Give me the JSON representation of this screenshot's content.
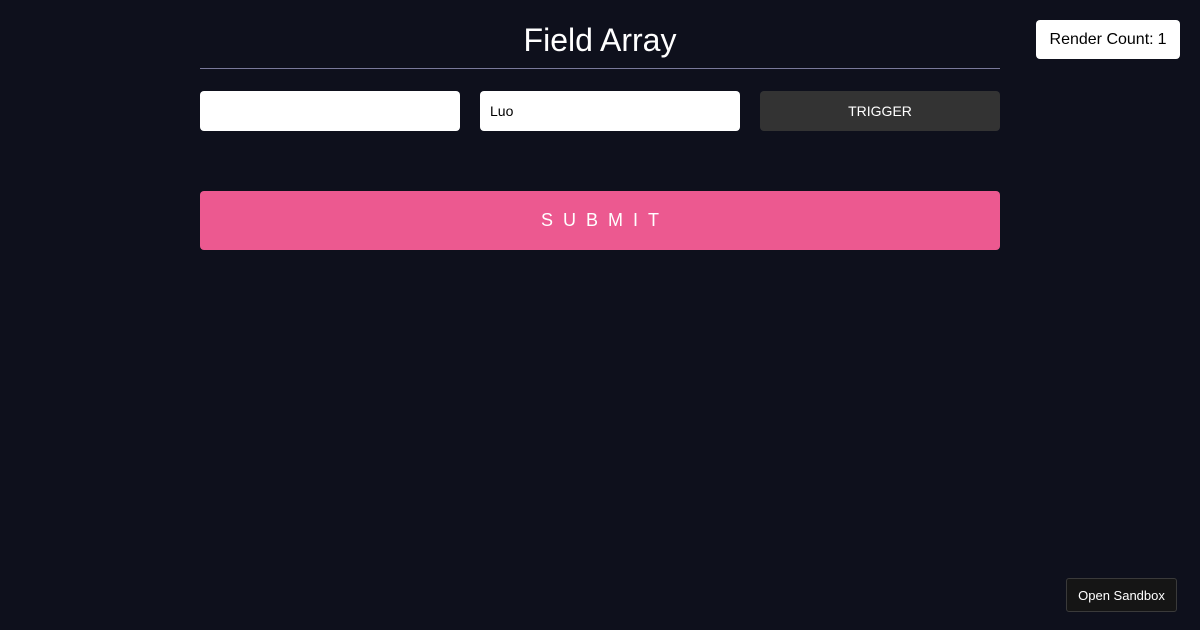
{
  "render_count": {
    "label": "Render Count:",
    "value": "1"
  },
  "header": {
    "title": "Field Array"
  },
  "form": {
    "fields": [
      {
        "value": "",
        "placeholder": ""
      },
      {
        "value": "Luo",
        "placeholder": ""
      }
    ],
    "trigger_label": "Trigger",
    "submit_label": "Submit"
  },
  "footer": {
    "sandbox_label": "Open Sandbox"
  },
  "colors": {
    "background": "#0e101c",
    "submit": "#ec5990",
    "trigger": "#333333",
    "divider": "#79799a"
  }
}
